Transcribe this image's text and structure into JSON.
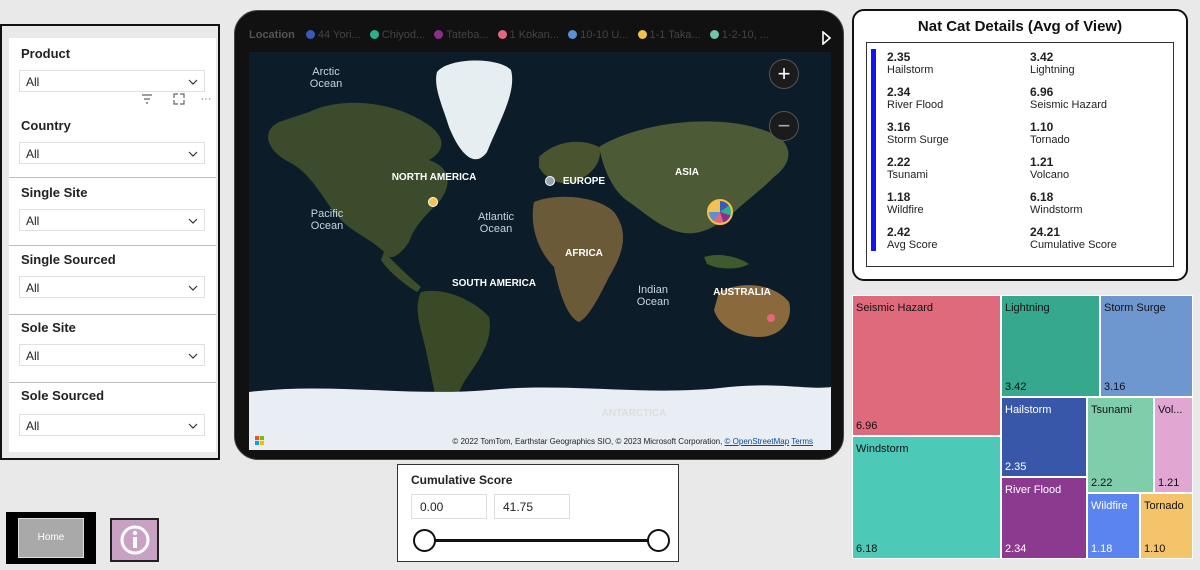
{
  "filters": {
    "slicers": [
      {
        "title": "Product",
        "value": "All"
      },
      {
        "title": "Country",
        "value": "All"
      },
      {
        "title": "Single Site",
        "value": "All"
      },
      {
        "title": "Single Sourced",
        "value": "All"
      },
      {
        "title": "Sole Site",
        "value": "All"
      },
      {
        "title": "Sole Sourced",
        "value": "All"
      }
    ],
    "more_label": "···"
  },
  "map": {
    "legend_title": "Location",
    "legend_items": [
      {
        "label": "44 Yori...",
        "color": "#3a59b8"
      },
      {
        "label": "Chiyod...",
        "color": "#2ab18c"
      },
      {
        "label": "Tateba...",
        "color": "#8b2f8d"
      },
      {
        "label": "1 Kokan...",
        "color": "#e06a7c"
      },
      {
        "label": "10-10 U...",
        "color": "#5b8fd6"
      },
      {
        "label": "1-1 Taka...",
        "color": "#f2c14e"
      },
      {
        "label": "1-2-10, ...",
        "color": "#6fc7a9"
      }
    ],
    "labels": {
      "arctic": "Arctic Ocean",
      "north_america": "NORTH AMERICA",
      "europe": "EUROPE",
      "asia": "ASIA",
      "pacific": "Pacific Ocean",
      "atlantic": "Atlantic Ocean",
      "africa": "AFRICA",
      "south_america": "SOUTH AMERICA",
      "indian": "Indian Ocean",
      "australia": "AUSTRALIA",
      "antarctica": "ANTARCTICA"
    },
    "zoom_in": "+",
    "zoom_out": "−",
    "bing": "Microsoft Bing",
    "attribution": "© 2022 TomTom, Earthstar Geographics SIO, © 2023 Microsoft Corporation,",
    "osm": "© OpenStreetMap",
    "terms": "Terms"
  },
  "details": {
    "title": "Nat Cat Details (Avg of View)",
    "items": [
      {
        "value": "2.35",
        "label": "Hailstorm"
      },
      {
        "value": "3.42",
        "label": "Lightning"
      },
      {
        "value": "2.34",
        "label": "River Flood"
      },
      {
        "value": "6.96",
        "label": "Seismic Hazard"
      },
      {
        "value": "3.16",
        "label": "Storm Surge"
      },
      {
        "value": "1.10",
        "label": "Tornado"
      },
      {
        "value": "2.22",
        "label": "Tsunami"
      },
      {
        "value": "1.21",
        "label": "Volcano"
      },
      {
        "value": "1.18",
        "label": "Wildfire"
      },
      {
        "value": "6.18",
        "label": "Windstorm"
      },
      {
        "value": "2.42",
        "label": "Avg Score"
      },
      {
        "value": "24.21",
        "label": "Cumulative Score"
      }
    ]
  },
  "treemap": {
    "tiles": [
      {
        "name": "Seismic Hazard",
        "value": "6.96",
        "color": "#df6a7c"
      },
      {
        "name": "Lightning",
        "value": "3.42",
        "color": "#35a88e"
      },
      {
        "name": "Storm Surge",
        "value": "3.16",
        "color": "#6f97cf"
      },
      {
        "name": "Windstorm",
        "value": "6.18",
        "color": "#4dc9b8"
      },
      {
        "name": "Hailstorm",
        "value": "2.35",
        "color": "#3857a8"
      },
      {
        "name": "Tsunami",
        "value": "2.22",
        "color": "#7fcdab"
      },
      {
        "name": "Vol...",
        "value": "1.21",
        "color": "#e2a6d2"
      },
      {
        "name": "River Flood",
        "value": "2.34",
        "color": "#8c3a8f"
      },
      {
        "name": "Wildfire",
        "value": "1.18",
        "color": "#5b84f0"
      },
      {
        "name": "Tornado",
        "value": "1.10",
        "color": "#f3c46a"
      }
    ]
  },
  "cumulative": {
    "title": "Cumulative Score",
    "min": "0.00",
    "max": "41.75"
  },
  "nav": {
    "home_label": "Home"
  }
}
